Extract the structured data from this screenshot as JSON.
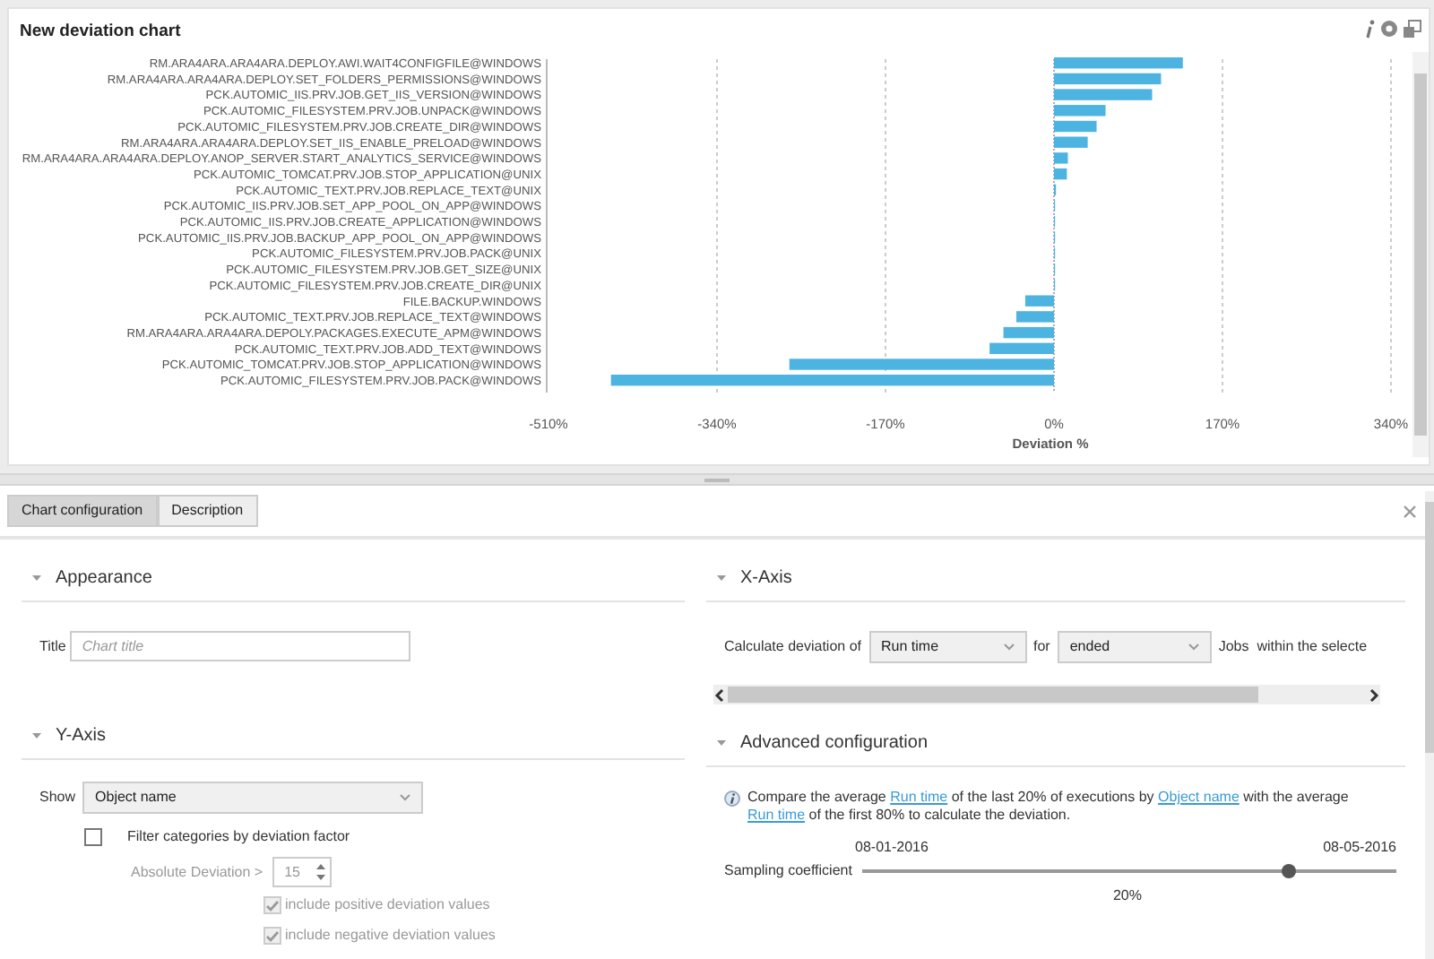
{
  "chart_panel": {
    "title": "New deviation chart",
    "chart_data": {
      "type": "bar",
      "orientation": "horizontal",
      "grid": true,
      "ref_lines": [
        {
          "axis": "x",
          "value": 0
        }
      ],
      "xlabel": "Deviation %",
      "xlim": [
        -510,
        340
      ],
      "xticks": [
        {
          "value": -510,
          "label": "-510%"
        },
        {
          "value": -340,
          "label": "-340%"
        },
        {
          "value": -170,
          "label": "-170%"
        },
        {
          "value": 0,
          "label": "0%"
        },
        {
          "value": 170,
          "label": "170%"
        },
        {
          "value": 340,
          "label": "340%"
        }
      ],
      "categories": [
        "RM.ARA4ARA.ARA4ARA.DEPLOY.AWI.WAIT4CONFIGFILE@WINDOWS",
        "RM.ARA4ARA.ARA4ARA.DEPLOY.SET_FOLDERS_PERMISSIONS@WINDOWS",
        "PCK.AUTOMIC_IIS.PRV.JOB.GET_IIS_VERSION@WINDOWS",
        "PCK.AUTOMIC_FILESYSTEM.PRV.JOB.UNPACK@WINDOWS",
        "PCK.AUTOMIC_FILESYSTEM.PRV.JOB.CREATE_DIR@WINDOWS",
        "RM.ARA4ARA.ARA4ARA.DEPLOY.SET_IIS_ENABLE_PRELOAD@WINDOWS",
        "RM.ARA4ARA.ARA4ARA.DEPLOY.ANOP_SERVER.START_ANALYTICS_SERVICE@WINDOWS",
        "PCK.AUTOMIC_TOMCAT.PRV.JOB.STOP_APPLICATION@UNIX",
        "PCK.AUTOMIC_TEXT.PRV.JOB.REPLACE_TEXT@UNIX",
        "PCK.AUTOMIC_IIS.PRV.JOB.SET_APP_POOL_ON_APP@WINDOWS",
        "PCK.AUTOMIC_IIS.PRV.JOB.CREATE_APPLICATION@WINDOWS",
        "PCK.AUTOMIC_IIS.PRV.JOB.BACKUP_APP_POOL_ON_APP@WINDOWS",
        "PCK.AUTOMIC_FILESYSTEM.PRV.JOB.PACK@UNIX",
        "PCK.AUTOMIC_FILESYSTEM.PRV.JOB.GET_SIZE@UNIX",
        "PCK.AUTOMIC_FILESYSTEM.PRV.JOB.CREATE_DIR@UNIX",
        "FILE.BACKUP.WINDOWS",
        "PCK.AUTOMIC_TEXT.PRV.JOB.REPLACE_TEXT@WINDOWS",
        "RM.ARA4ARA.ARA4ARA.DEPOLY.PACKAGES.EXECUTE_APM@WINDOWS",
        "PCK.AUTOMIC_TEXT.PRV.JOB.ADD_TEXT@WINDOWS",
        "PCK.AUTOMIC_TOMCAT.PRV.JOB.STOP_APPLICATION@WINDOWS",
        "PCK.AUTOMIC_FILESYSTEM.PRV.JOB.PACK@WINDOWS"
      ],
      "series": [
        {
          "color": "#4db3e0",
          "values": [
            130,
            108,
            99,
            52,
            43,
            34,
            14,
            13,
            2,
            1,
            1,
            0,
            0,
            0,
            0,
            -29,
            -38,
            -51,
            -65,
            -267,
            -447
          ]
        }
      ]
    }
  },
  "tabs": [
    {
      "label": "Chart configuration",
      "selected": true
    },
    {
      "label": "Description",
      "selected": false
    }
  ],
  "appearance": {
    "heading": "Appearance",
    "title_field": {
      "label": "Title",
      "placeholder": "Chart title"
    }
  },
  "y_axis": {
    "heading": "Y-Axis",
    "show": {
      "label": "Show",
      "value": "Object name"
    },
    "filter": {
      "label": "Filter categories by deviation factor",
      "checked": false
    },
    "absolute_deviation": {
      "label": "Absolute Deviation >",
      "value": "15",
      "disabled": true
    },
    "options": [
      {
        "label": "include positive deviation values",
        "checked": true,
        "disabled": true
      },
      {
        "label": "include negative deviation values",
        "checked": true,
        "disabled": true
      }
    ]
  },
  "x_axis": {
    "heading": "X-Axis",
    "prefix": "Calculate deviation of",
    "measure": "Run time",
    "for_label": "for",
    "status": "ended",
    "suffix": "Jobs  within the selecte"
  },
  "advanced": {
    "heading": "Advanced configuration",
    "info": [
      {
        "kind": "text",
        "text": "Compare the average "
      },
      {
        "kind": "link",
        "text": "Run time"
      },
      {
        "kind": "text",
        "text": " of the last 20% of executions by "
      },
      {
        "kind": "link",
        "text": "Object name"
      },
      {
        "kind": "text",
        "text": " with the average "
      },
      {
        "kind": "link",
        "text": "Run time"
      },
      {
        "kind": "text",
        "text": " of the first 80% to calculate the deviation."
      }
    ],
    "slider": {
      "label": "Sampling coefficient",
      "start": "08-01-2016",
      "end": "08-05-2016",
      "level": 0.8,
      "reading": "20%"
    }
  }
}
